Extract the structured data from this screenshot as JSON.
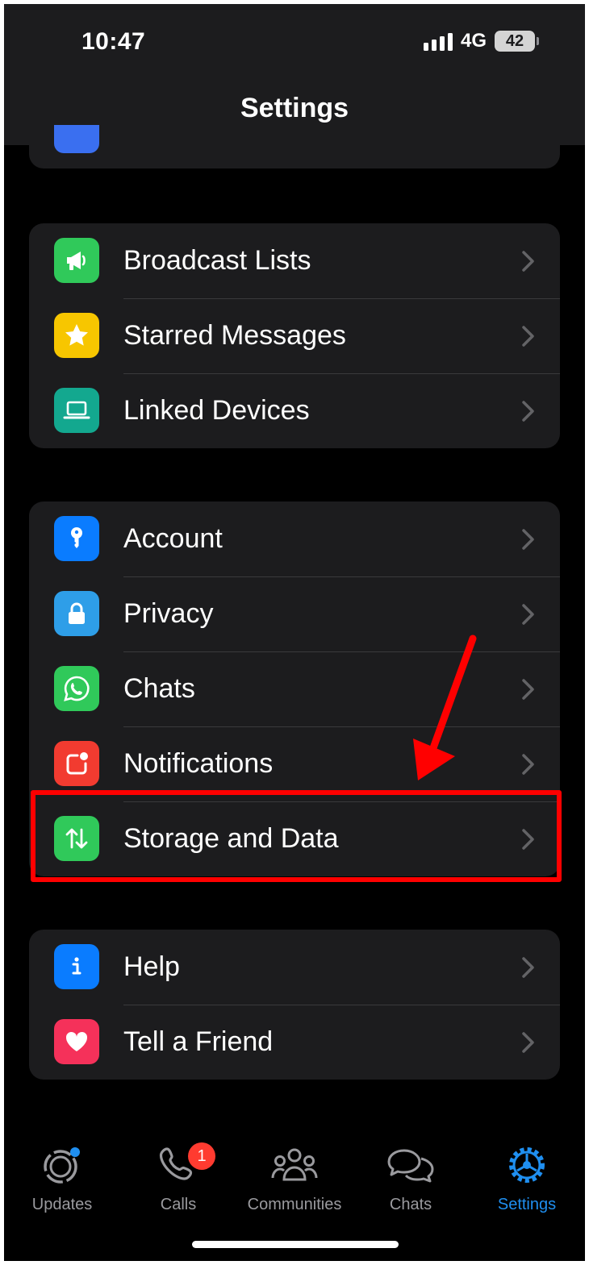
{
  "status_bar": {
    "time": "10:47",
    "network": "4G",
    "battery": "42"
  },
  "header": {
    "title": "Settings"
  },
  "groups": [
    {
      "items": [
        {
          "label": "Broadcast Lists",
          "icon": "megaphone-icon",
          "color": "#30c95a"
        },
        {
          "label": "Starred Messages",
          "icon": "star-icon",
          "color": "#f7c600"
        },
        {
          "label": "Linked Devices",
          "icon": "laptop-icon",
          "color": "#13a88f"
        }
      ]
    },
    {
      "items": [
        {
          "label": "Account",
          "icon": "key-icon",
          "color": "#0a7cff"
        },
        {
          "label": "Privacy",
          "icon": "lock-icon",
          "color": "#2e9ee8"
        },
        {
          "label": "Chats",
          "icon": "whatsapp-icon",
          "color": "#30c95a"
        },
        {
          "label": "Notifications",
          "icon": "notification-icon",
          "color": "#f23b30"
        },
        {
          "label": "Storage and Data",
          "icon": "arrows-updown-icon",
          "color": "#30c95a"
        }
      ]
    },
    {
      "items": [
        {
          "label": "Help",
          "icon": "info-icon",
          "color": "#0a7cff"
        },
        {
          "label": "Tell a Friend",
          "icon": "heart-icon",
          "color": "#f5315a"
        }
      ]
    }
  ],
  "tabbar": {
    "tabs": [
      {
        "label": "Updates",
        "icon": "updates-icon"
      },
      {
        "label": "Calls",
        "icon": "phone-icon",
        "badge": "1"
      },
      {
        "label": "Communities",
        "icon": "communities-icon"
      },
      {
        "label": "Chats",
        "icon": "chat-bubbles-icon"
      },
      {
        "label": "Settings",
        "icon": "gear-icon",
        "active": true
      }
    ]
  },
  "colors": {
    "accent": "#1f8ff0",
    "annotation": "#ff0000",
    "cell_background": "#1c1c1e"
  }
}
